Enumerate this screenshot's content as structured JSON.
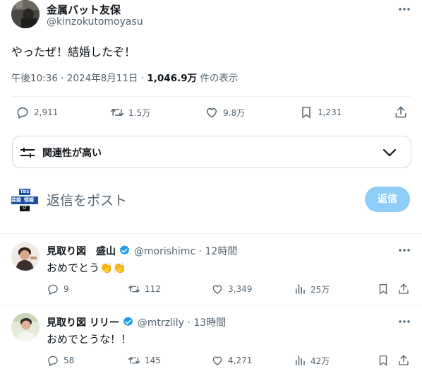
{
  "tweet": {
    "author_name": "金属バット友保",
    "author_handle": "@kinzokutomoyasu",
    "text": "やったぜ！結婚したぞ！",
    "time": "午後10:36",
    "date": "2024年8月11日",
    "views_count": "1,046.9万",
    "views_label": "件の表示",
    "dot": "·",
    "replies": "2,911",
    "retweets": "1.5万",
    "likes": "9.8万",
    "bookmarks": "1,231"
  },
  "sort": {
    "label": "関連性が高い"
  },
  "composer": {
    "placeholder": "返信をポスト",
    "avatar_text": [
      "TBS",
      "芸能",
      "情報",
      "ST"
    ],
    "reply_button": "返信"
  },
  "replies": [
    {
      "name": "見取り図　盛山",
      "handle": "@morishimc",
      "time": "· 12時間",
      "text": "おめでとう",
      "emoji": "👏👏",
      "replies": "9",
      "retweets": "112",
      "likes": "3,349",
      "views": "25万"
    },
    {
      "name": "見取り図 リリー",
      "handle": "@mtrzlily",
      "time": "· 13時間",
      "text": "おめでとうな！！",
      "emoji": "",
      "replies": "58",
      "retweets": "145",
      "likes": "4,271",
      "views": "42万"
    }
  ],
  "colors": {
    "accent": "#1d9bf0",
    "reply_button_disabled": "#8ecdf8",
    "verified": "#1d9bf0",
    "muted": "#536471"
  },
  "icons": [
    "more-icon",
    "reply-icon",
    "retweet-icon",
    "like-icon",
    "bookmark-icon",
    "share-icon",
    "views-icon",
    "filter-icon",
    "chevron-down-icon",
    "verified-badge-icon"
  ]
}
